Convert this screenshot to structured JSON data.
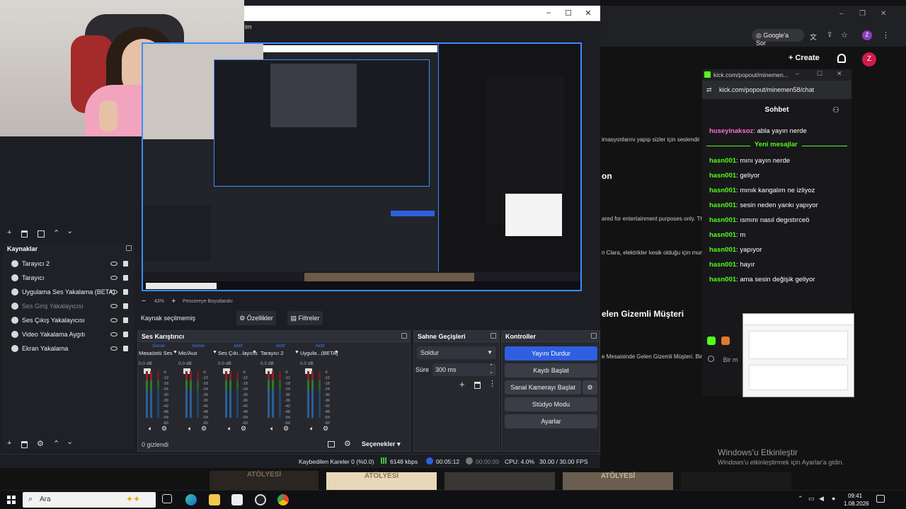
{
  "obs": {
    "menu_item_partial": "im",
    "sources_header": "Kaynaklar",
    "sources": [
      {
        "label": "Tarayıcı 2",
        "dim": false
      },
      {
        "label": "Tarayıcı",
        "dim": false
      },
      {
        "label": "Uygulama Ses Yakalama (BETA)",
        "dim": false
      },
      {
        "label": "Ses Giriş Yakalayıcısı",
        "dim": true
      },
      {
        "label": "Ses Çıkış Yakalayıcısı",
        "dim": false
      },
      {
        "label": "Video Yakalama Aygıtı",
        "dim": false
      },
      {
        "label": "Ekran Yakalama",
        "dim": false
      }
    ],
    "zoom": "43%",
    "zoom_label": "Pencereye Boyutlandır",
    "no_source": "Kaynak seçilmemiş",
    "properties_btn": "Özellikler",
    "filters_btn": "Filtreler",
    "mixer_header": "Ses Karıştırıcı",
    "mixer": [
      {
        "tag": "Genel",
        "name": "Masaüstü Ses"
      },
      {
        "tag": "Genel",
        "name": "Mic/Aux"
      },
      {
        "tag": "Aktif",
        "name": "Ses Çıkı...layıcısı"
      },
      {
        "tag": "Aktif",
        "name": "Tarayıcı 2"
      },
      {
        "tag": "Aktif",
        "name": "Uygula...(BETA)"
      }
    ],
    "scale": [
      "0.0 dB",
      "0.0 dB",
      "0.0 dB",
      "0.0 dB",
      "0.0 dB"
    ],
    "hidden": "0 gizlendi",
    "selectors": "Seçenekler",
    "transitions_header": "Sahne Geçişleri",
    "transition_value": "Soldur",
    "duration_label": "Süre",
    "duration_value": "300 ms",
    "controls_header": "Kontroller",
    "controls": [
      "Yayını Durdur",
      "Kaydı Başlat",
      "Sanal Kamerayı Başlat",
      "Stüdyo Modu",
      "Ayarlar"
    ],
    "status": {
      "dropped": "Kaybedilen Kareler 0 (%0.0)",
      "bitrate": "6148 kbps",
      "stream_time": "00:05:12",
      "rec_time": "00:00:00",
      "cpu": "CPU: 4.0%",
      "fps": "30.00 / 30.00 FPS"
    }
  },
  "browser": {
    "google_btn": "Google'a Sor",
    "create_btn": "Create",
    "avatar": "Z",
    "bg_text": [
      "imasyonlarını yapıp sizler için seslendir",
      "on",
      "ared for entertainment purposes only. Th",
      "n Clara, elektrikler kesik olduğu için mum",
      "elen Gizemli Müşteri",
      "e Mesaisinde Gelen Gizemli Müşteri. Bir"
    ],
    "input_partial": "Bir m"
  },
  "chat": {
    "title_bar": "kick.com/popout/minemen...",
    "url": "kick.com/popout/minemen58/chat",
    "header": "Sohbet",
    "first": {
      "user": "huseyinaksoz",
      "text": "abla yayın nerde"
    },
    "new_messages": "Yeni mesajlar",
    "messages": [
      {
        "user": "hasn001",
        "text": "mını yayın nerde"
      },
      {
        "user": "hasn001",
        "text": "geliyor"
      },
      {
        "user": "hasn001",
        "text": "mınık kangalım ne izliyoz"
      },
      {
        "user": "hasn001",
        "text": "sesin neden yankı yapıyor"
      },
      {
        "user": "hasn001",
        "text": "ısmını nasıl degıstırceö"
      },
      {
        "user": "hasn001",
        "text": "m"
      },
      {
        "user": "hasn001",
        "text": "yapıyor"
      },
      {
        "user": "hasn001",
        "text": "hayır"
      },
      {
        "user": "hasn001",
        "text": "ama sesin değişik geliyor"
      }
    ]
  },
  "windows": {
    "activate_title": "Windows'u Etkinleştir",
    "activate_sub": "Windows'u etkinleştirmek için Ayarlar'a gidin.",
    "search": "Ara",
    "time": "09:41",
    "date": "1.08.2026",
    "thumb_text": "ATÖLYESİ"
  },
  "colors": {
    "accent": "#2f5fe0",
    "kick_green": "#53fc18",
    "purple_avatar": "#8a3dc1"
  }
}
